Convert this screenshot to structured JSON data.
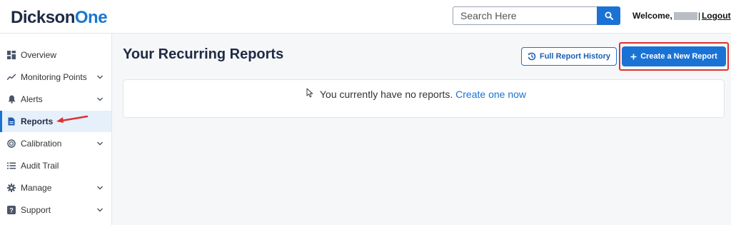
{
  "header": {
    "logo_part1": "Dickson",
    "logo_part2": "One",
    "search_placeholder": "Search Here",
    "search_icon": "search-icon",
    "welcome_label": "Welcome,",
    "separator": "|",
    "logout_label": "Logout"
  },
  "sidebar": {
    "items": [
      {
        "label": "Overview",
        "icon": "dashboard-icon",
        "expandable": false
      },
      {
        "label": "Monitoring Points",
        "icon": "trend-line-icon",
        "expandable": true
      },
      {
        "label": "Alerts",
        "icon": "bell-icon",
        "expandable": true
      },
      {
        "label": "Reports",
        "icon": "document-icon",
        "expandable": false,
        "active": true
      },
      {
        "label": "Calibration",
        "icon": "target-icon",
        "expandable": true
      },
      {
        "label": "Audit Trail",
        "icon": "list-icon",
        "expandable": false
      },
      {
        "label": "Manage",
        "icon": "gear-icon",
        "expandable": true
      },
      {
        "label": "Support",
        "icon": "help-icon",
        "expandable": true
      }
    ]
  },
  "main": {
    "title": "Your Recurring Reports",
    "history_button": "Full Report History",
    "create_button": "Create a New Report",
    "empty_message": "You currently have no reports.",
    "empty_link": "Create one now"
  },
  "colors": {
    "accent": "#1a73d4",
    "highlight": "#e03131",
    "navy": "#1f2a44"
  }
}
